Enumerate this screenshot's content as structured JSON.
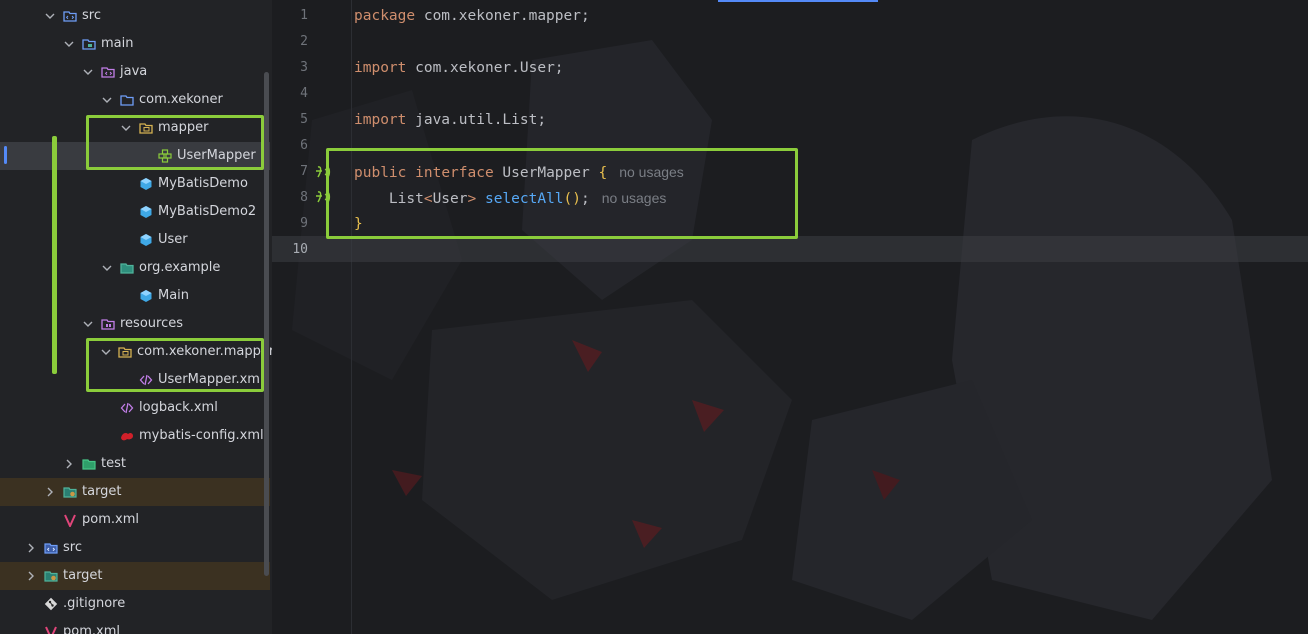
{
  "colors": {
    "highlight": "#8bcc3b",
    "keyword": "#cf8e6d",
    "function": "#56a8f5",
    "text": "#bcbec4",
    "accent": "#548af7"
  },
  "tree": {
    "items": [
      {
        "label": "src",
        "icon": "source-folder-icon"
      },
      {
        "label": "main",
        "icon": "folder-icon"
      },
      {
        "label": "java",
        "icon": "source-root-icon"
      },
      {
        "label": "com.xekoner",
        "icon": "package-icon"
      },
      {
        "label": "mapper",
        "icon": "package-icon"
      },
      {
        "label": "UserMapper",
        "icon": "interface-icon"
      },
      {
        "label": "MyBatisDemo",
        "icon": "class-icon"
      },
      {
        "label": "MyBatisDemo2",
        "icon": "class-icon"
      },
      {
        "label": "User",
        "icon": "class-icon"
      },
      {
        "label": "org.example",
        "icon": "package-icon"
      },
      {
        "label": "Main",
        "icon": "class-icon"
      },
      {
        "label": "resources",
        "icon": "resources-folder-icon"
      },
      {
        "label": "com.xekoner.mapper",
        "icon": "package-icon"
      },
      {
        "label": "UserMapper.xml",
        "icon": "xml-file-icon"
      },
      {
        "label": "logback.xml",
        "icon": "xml-file-icon"
      },
      {
        "label": "mybatis-config.xml",
        "icon": "mybatis-icon"
      },
      {
        "label": "test",
        "icon": "test-folder-icon"
      },
      {
        "label": "target",
        "icon": "excluded-folder-icon"
      },
      {
        "label": "pom.xml",
        "icon": "maven-icon"
      },
      {
        "label": "src",
        "icon": "source-folder-icon"
      },
      {
        "label": "target",
        "icon": "excluded-folder-icon"
      },
      {
        "label": ".gitignore",
        "icon": "git-icon"
      },
      {
        "label": "pom.xml",
        "icon": "maven-icon"
      }
    ]
  },
  "editor": {
    "line_numbers": [
      "1",
      "2",
      "3",
      "4",
      "5",
      "6",
      "7",
      "8",
      "9",
      "10"
    ],
    "current_line": "10",
    "lines": {
      "l1": {
        "kw": "package",
        "rest": " com.xekoner.mapper;"
      },
      "l3": {
        "kw": "import",
        "rest": " com.xekoner.User;"
      },
      "l5": {
        "kw": "import",
        "rest": " java.util.List;"
      },
      "l7": {
        "kw1": "public",
        "kw2": "interface",
        "name": " UserMapper ",
        "brace": "{",
        "hint": "no usages"
      },
      "l8": {
        "type": "List",
        "lt": "<",
        "generic": "User",
        "gt": ">",
        "method": "selectAll",
        "parens": "()",
        "semi": ";",
        "hint": "no usages"
      },
      "l9": {
        "brace": "}"
      }
    }
  }
}
